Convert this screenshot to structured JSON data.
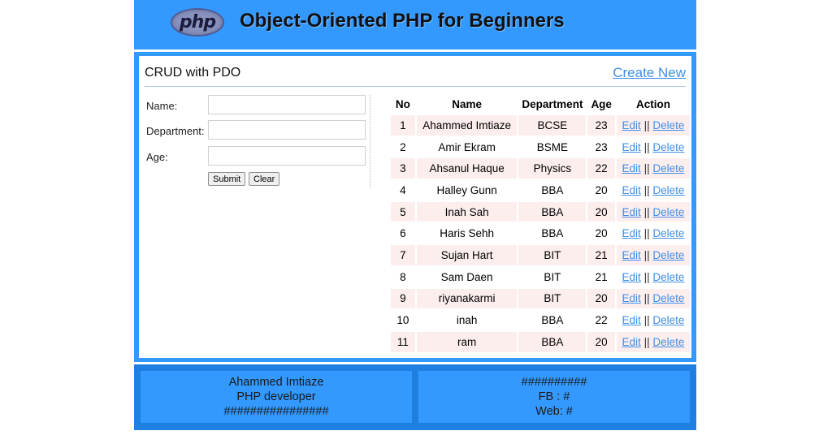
{
  "header": {
    "logo_text": "php",
    "title": "Object-Oriented PHP for Beginners"
  },
  "panel": {
    "title": "CRUD with PDO",
    "create_new": "Create New"
  },
  "form": {
    "name_label": "Name:",
    "department_label": "Department:",
    "age_label": "Age:",
    "name_value": "",
    "department_value": "",
    "age_value": "",
    "submit_label": "Submit",
    "clear_label": "Clear"
  },
  "table": {
    "headers": [
      "No",
      "Name",
      "Department",
      "Age",
      "Action"
    ],
    "edit_label": "Edit",
    "separator": "||",
    "delete_label": "Delete",
    "rows": [
      {
        "no": "1",
        "name": "Ahammed Imtiaze",
        "dept": "BCSE",
        "age": "23"
      },
      {
        "no": "2",
        "name": "Amir Ekram",
        "dept": "BSME",
        "age": "23"
      },
      {
        "no": "3",
        "name": "Ahsanul Haque",
        "dept": "Physics",
        "age": "22"
      },
      {
        "no": "4",
        "name": "Halley Gunn",
        "dept": "BBA",
        "age": "20"
      },
      {
        "no": "5",
        "name": "Inah Sah",
        "dept": "BBA",
        "age": "20"
      },
      {
        "no": "6",
        "name": "Haris Sehh",
        "dept": "BBA",
        "age": "20"
      },
      {
        "no": "7",
        "name": "Sujan Hart",
        "dept": "BIT",
        "age": "21"
      },
      {
        "no": "8",
        "name": "Sam Daen",
        "dept": "BIT",
        "age": "21"
      },
      {
        "no": "9",
        "name": "riyanakarmi",
        "dept": "BIT",
        "age": "20"
      },
      {
        "no": "10",
        "name": "inah",
        "dept": "BBA",
        "age": "22"
      },
      {
        "no": "11",
        "name": "ram",
        "dept": "BBA",
        "age": "20"
      }
    ]
  },
  "footer": {
    "left": [
      "Ahammed Imtiaze",
      "PHP developer",
      "################"
    ],
    "right": [
      "##########",
      "FB : #",
      "Web: #"
    ]
  },
  "colors": {
    "primary": "#3399ff",
    "footer_bg": "#1e7fe0",
    "link": "#3f8ee8",
    "row_stripe": "#fdeeee"
  }
}
